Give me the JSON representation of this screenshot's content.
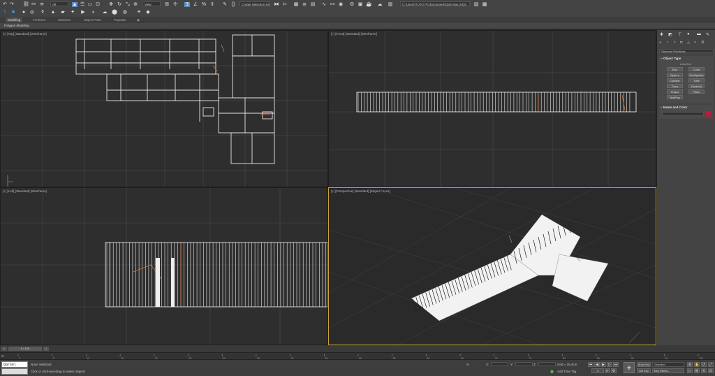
{
  "toolbar": {
    "filter_value": "All",
    "view_value": "View",
    "named_selection_placeholder": "Create Selection Se",
    "project_path": "C:\\Users\\TUTO PC\\Documents\\3ds Max 2020"
  },
  "ribbon": {
    "tabs": [
      "Modeling",
      "Freeform",
      "Selection",
      "Object Paint",
      "Populate"
    ],
    "active_tab": "Modeling",
    "subtitle": "Polygon Modeling"
  },
  "viewports": {
    "top": "[+] [Top] [Standard] [Wireframe]",
    "front": "[+] [Front] [Standard] [Wireframe]",
    "left": "[+] [Left] [Standard] [Wireframe]",
    "perspective": "[+] [Perspective] [Standard] [Edged Faces]"
  },
  "command_panel": {
    "category": "Standard Primitives",
    "object_type_title": "Object Type",
    "autogrid": "AutoGrid",
    "primitives": [
      "Box",
      "Cone",
      "Sphere",
      "GeoSphere",
      "Cylinder",
      "Tube",
      "Torus",
      "Pyramid",
      "Teapot",
      "Plane",
      "TextPlus"
    ],
    "name_color_title": "Name and Color",
    "object_color": "#b0203a"
  },
  "timeline": {
    "frame_counter": "0 / 100",
    "ticks": [
      "0",
      "5",
      "10",
      "15",
      "20",
      "25",
      "30",
      "35",
      "40",
      "45",
      "50",
      "55",
      "60",
      "65",
      "70",
      "75",
      "80",
      "85",
      "90",
      "95",
      "100"
    ]
  },
  "status": {
    "script_label": "Qarsel Scrip",
    "selection_status": "None Selected",
    "prompt": "Click or click-and-drag to select objects",
    "x_label": "X:",
    "y_label": "Y:",
    "z_label": "Z:",
    "grid": "Grid = 25,4cm",
    "add_time_tag": "Add Time Tag",
    "auto_key": "Auto Key",
    "set_key": "Set Key",
    "selected_value": "Selected",
    "key_filters": "Key Filters...",
    "current_frame": "0"
  },
  "colors": {
    "accent": "#5a8ec4",
    "active_viewport_border": "#c9a33a",
    "wireframe_top": "#f0f0f0",
    "perspective_bg": "#2a2a2a"
  }
}
